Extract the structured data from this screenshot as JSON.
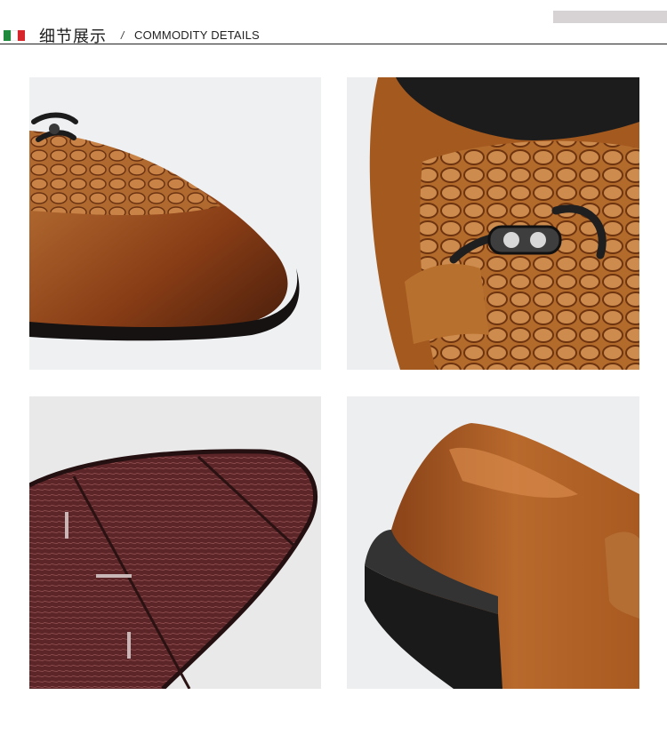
{
  "header": {
    "title_cn": "细节展示",
    "separator": "/",
    "title_en": "COMMODITY DETAILS",
    "flag_colors": [
      "#1f8a3b",
      "#ffffff",
      "#d7262c"
    ]
  },
  "photos": [
    {
      "subject": "toe-with-crocodile-pattern-and-buckle"
    },
    {
      "subject": "metal-horsebit-buckle-closeup"
    },
    {
      "subject": "textured-sole-closeup"
    },
    {
      "subject": "heel-and-side-closeup"
    }
  ],
  "colors": {
    "leather": "#a3561f",
    "leather_dark": "#5b2a10",
    "sole": "#5a2526",
    "background": "#eeeeee"
  }
}
